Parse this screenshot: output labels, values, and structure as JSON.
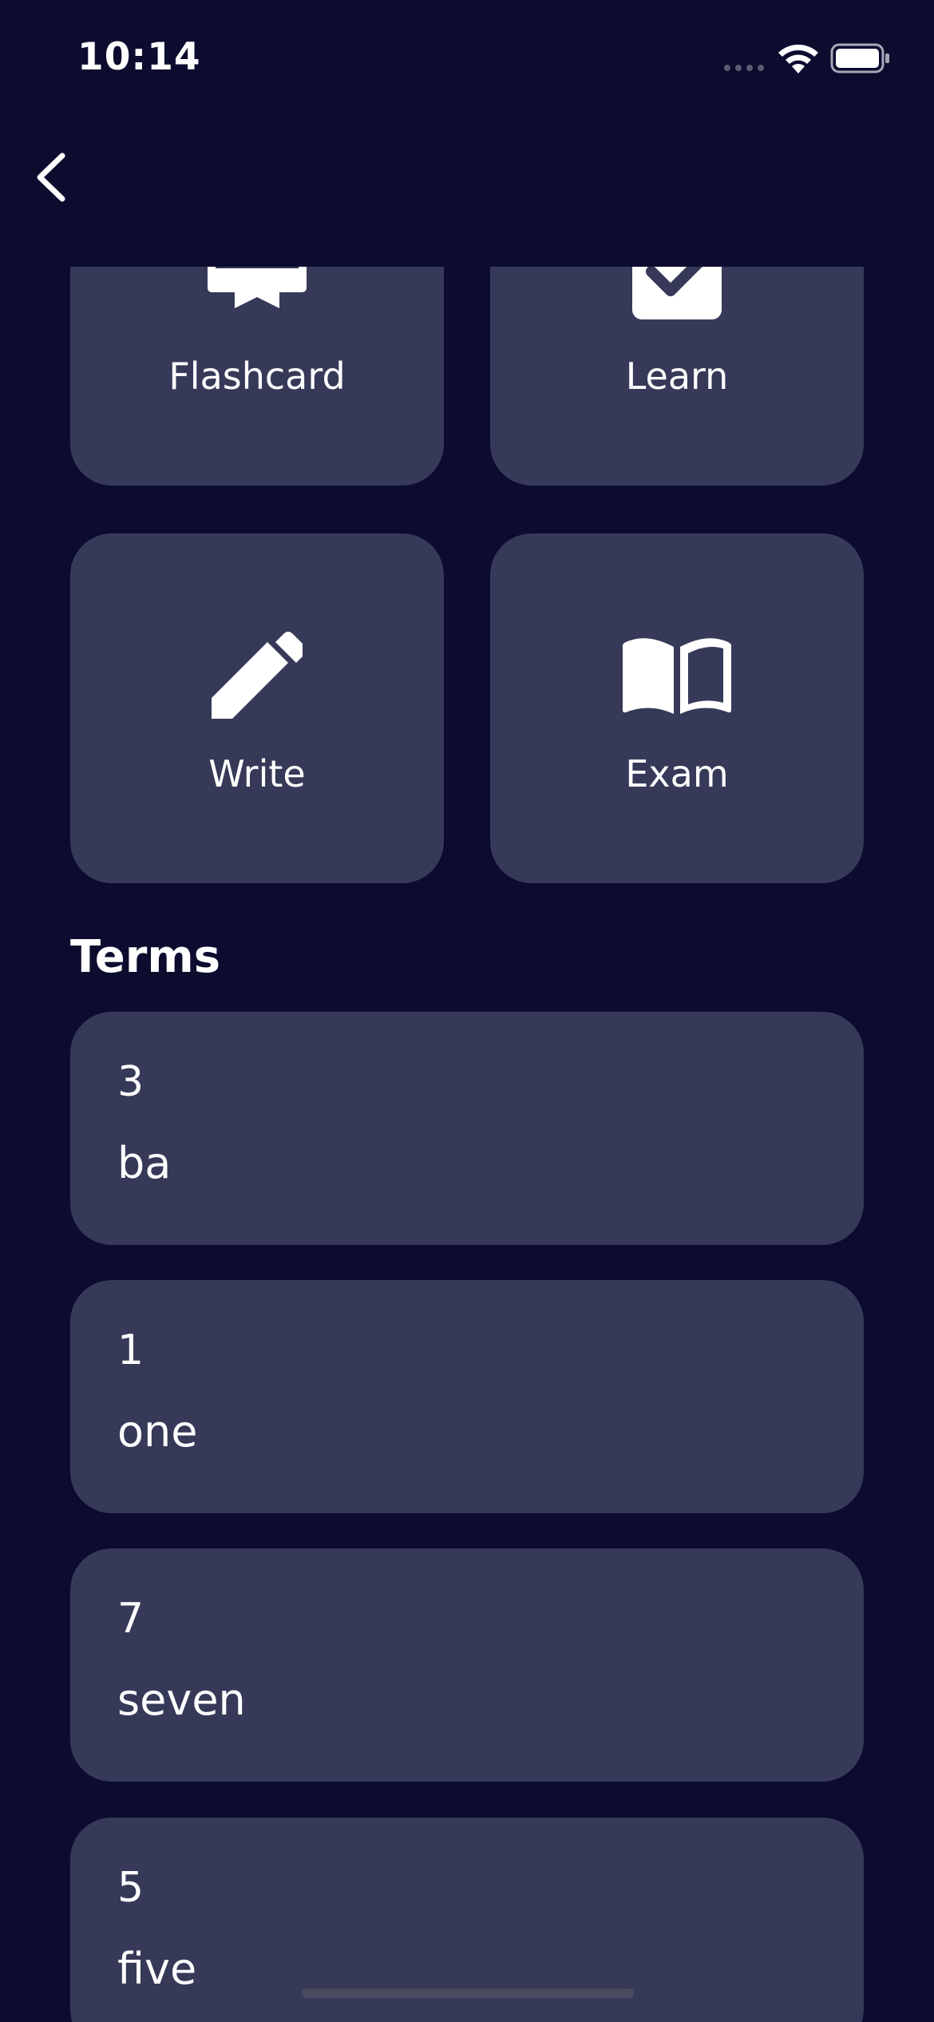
{
  "status_bar": {
    "time": "10:14"
  },
  "icons": {
    "back": "chevron-left-icon",
    "wifi": "wifi-icon",
    "battery": "battery-icon",
    "flashcard": "card-icon",
    "learn": "checkbox-icon",
    "write": "pencil-icon",
    "exam": "open-book-icon"
  },
  "modes": [
    {
      "label": "Flashcard"
    },
    {
      "label": "Learn"
    },
    {
      "label": "Write"
    },
    {
      "label": "Exam"
    }
  ],
  "terms_section": {
    "title": "Terms",
    "items": [
      {
        "term": "3",
        "definition": "ba"
      },
      {
        "term": "1",
        "definition": "one"
      },
      {
        "term": "7",
        "definition": "seven"
      },
      {
        "term": "5",
        "definition": "five"
      }
    ]
  },
  "colors": {
    "background": "#0b0c2e",
    "card": "#363a58",
    "text": "#ffffff"
  }
}
